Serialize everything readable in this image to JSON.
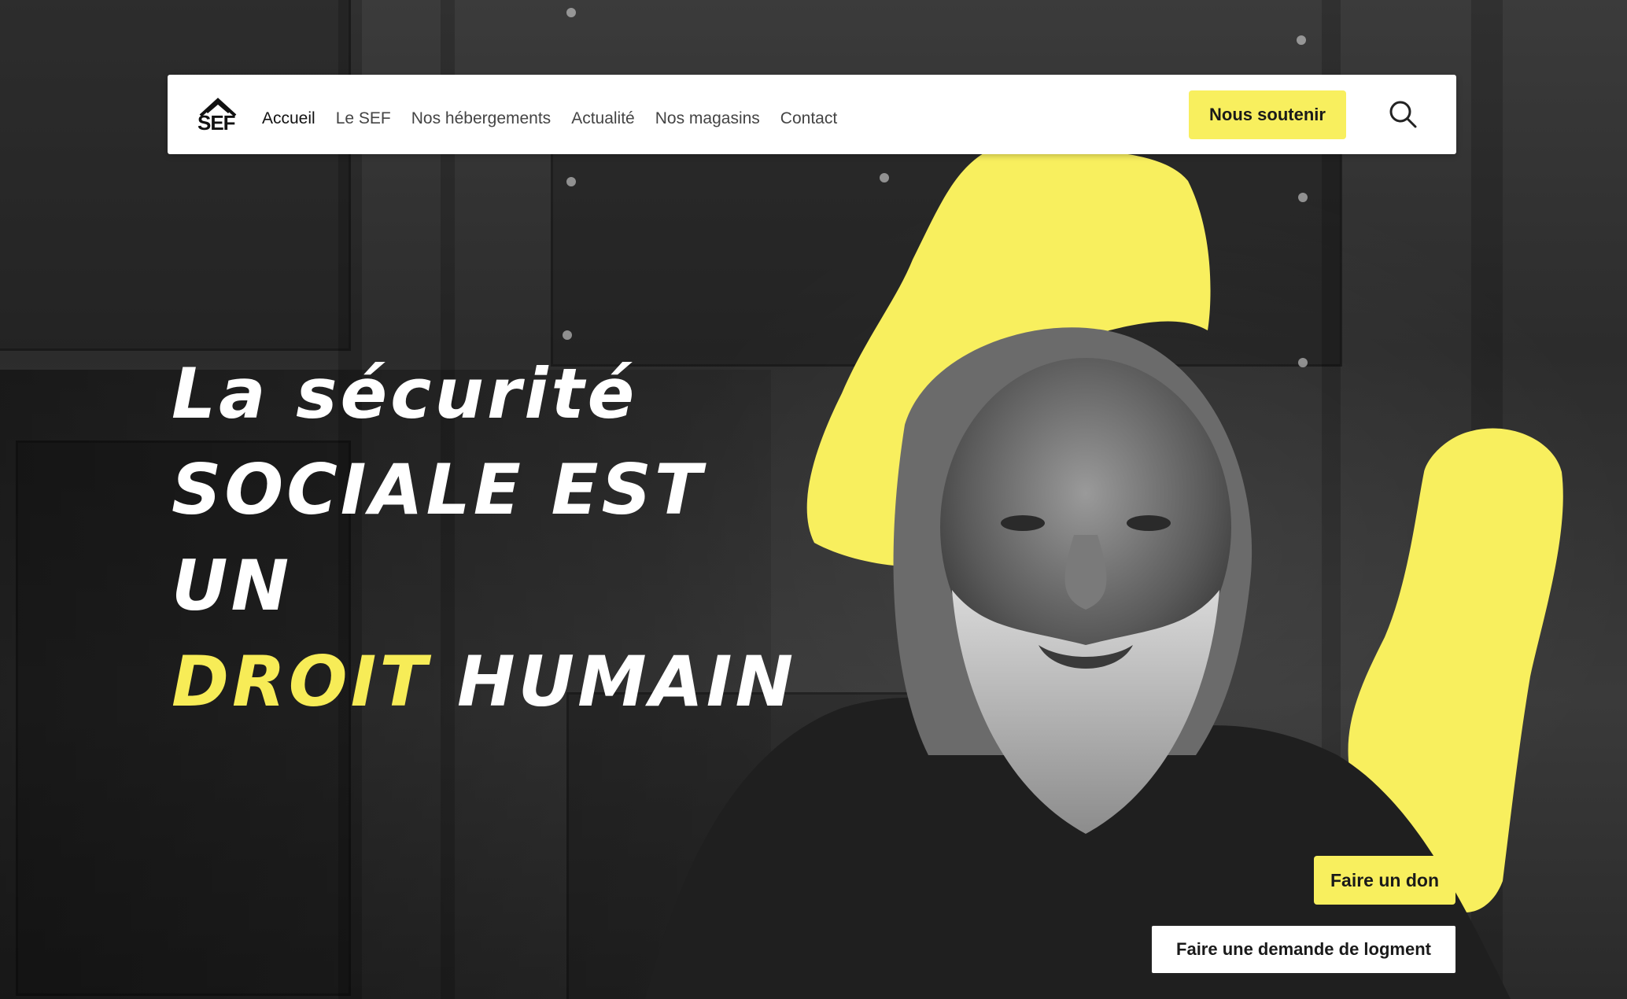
{
  "brand": {
    "logo_text": "SEF"
  },
  "nav": {
    "items": [
      {
        "label": "Accueil",
        "active": true
      },
      {
        "label": "Le SEF",
        "active": false
      },
      {
        "label": "Nos hébergements",
        "active": false
      },
      {
        "label": "Actualité",
        "active": false
      },
      {
        "label": "Nos magasins",
        "active": false
      },
      {
        "label": "Contact",
        "active": false
      }
    ],
    "support_label": "Nous soutenir",
    "search_icon": "search-icon"
  },
  "hero": {
    "line1": "La sécurité",
    "line2": "sociale est un",
    "highlight": "droit",
    "line3_rest": " humain"
  },
  "actions": {
    "donate_label": "Faire un don",
    "housing_label": "Faire une demande de logment"
  },
  "colors": {
    "accent": "#f8ef5e",
    "text_dark": "#1a1a1a",
    "nav_bg": "#ffffff"
  }
}
